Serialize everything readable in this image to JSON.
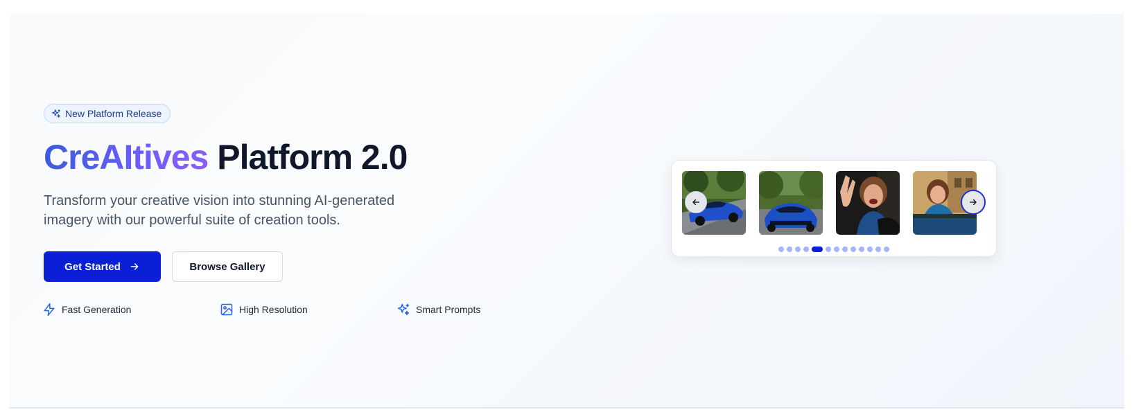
{
  "hero": {
    "badge_label": "New Platform Release",
    "badge_icon": "sparkles-icon",
    "title_brand": "CreAItives",
    "title_rest": " Platform 2.0",
    "subtitle": "Transform your creative vision into stunning AI-generated imagery with our powerful suite of creation tools.",
    "primary_button": "Get Started",
    "secondary_button": "Browse Gallery",
    "features": [
      {
        "label": "Fast Generation",
        "icon": "lightning-icon"
      },
      {
        "label": "High Resolution",
        "icon": "image-icon"
      },
      {
        "label": "Smart Prompts",
        "icon": "sparkles-icon"
      }
    ]
  },
  "carousel": {
    "images": [
      {
        "name": "blue-sports-car-road",
        "subject": "blue sports car on road"
      },
      {
        "name": "blue-sports-car-front",
        "subject": "blue sports car front view"
      },
      {
        "name": "woman-waving",
        "subject": "smiling woman waving"
      },
      {
        "name": "woman-car-window",
        "subject": "woman leaning out of car window"
      }
    ],
    "dot_count": 13,
    "active_dot": 4
  },
  "colors": {
    "accent": "#0a1fd6",
    "brand_gradient_start": "#3b5bdb",
    "brand_gradient_end": "#8b5cf6",
    "icon_blue": "#2563eb"
  }
}
